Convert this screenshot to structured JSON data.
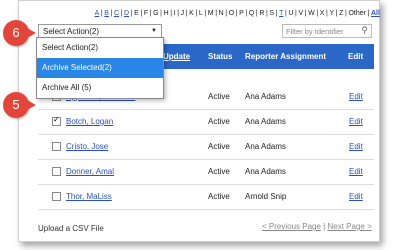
{
  "alphabet": [
    "A",
    "B",
    "C",
    "D",
    "E",
    "F",
    "G",
    "H",
    "I",
    "J",
    "K",
    "L",
    "M",
    "N",
    "O",
    "P",
    "Q",
    "R",
    "S",
    "T",
    "U",
    "V",
    "W",
    "X",
    "Y",
    "Z"
  ],
  "alphabet_underlined": [
    "A",
    "B",
    "C",
    "D",
    "T"
  ],
  "alphabet_other": "Other",
  "alphabet_all": "All",
  "action_select": {
    "value": "Select Action(2)"
  },
  "filter": {
    "placeholder": "Filter by Identifier"
  },
  "dropdown": {
    "options": [
      "Select Action(2)",
      "Archive Selected(2)",
      "Archive All (5)"
    ],
    "highlighted_index": 1
  },
  "table": {
    "headers": {
      "update": "Update",
      "status": "Status",
      "reporter": "Reporter Assignment",
      "edit": "Edit"
    },
    "rows": [
      {
        "name": "Appletino, Christine",
        "status": "Active",
        "reporter": "Ana Adams",
        "edit": "Edit",
        "checked": true
      },
      {
        "name": "Botch, Logan",
        "status": "Active",
        "reporter": "Ana Adams",
        "edit": "Edit",
        "checked": true
      },
      {
        "name": "Cristo, Jose",
        "status": "Active",
        "reporter": "Ana Adams",
        "edit": "Edit",
        "checked": false
      },
      {
        "name": "Donner, Amal",
        "status": "Active",
        "reporter": "Ana Adams",
        "edit": "Edit",
        "checked": false
      },
      {
        "name": "Thor, MaLiss",
        "status": "Active",
        "reporter": "Arnold Snip",
        "edit": "Edit",
        "checked": false
      }
    ]
  },
  "footer": {
    "upload": "Upload a CSV File",
    "prev": "< Previous Page",
    "separator": "|",
    "next": "Next Page >"
  },
  "badges": {
    "six": "6",
    "five": "5"
  },
  "colors": {
    "header_bg": "#2a67c7",
    "highlight": "#2a86e6",
    "badge": "#e2463a",
    "link": "#2b4fc6"
  }
}
